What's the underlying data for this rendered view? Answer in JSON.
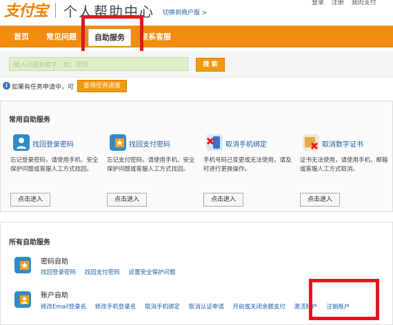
{
  "header": {
    "logo": "支付宝",
    "title": "个人帮助中心",
    "switch_link": "切换到商户版 >",
    "top_links": [
      "登录",
      "注册",
      "我的支付"
    ]
  },
  "nav": {
    "items": [
      {
        "label": "首页"
      },
      {
        "label": "常见问题"
      },
      {
        "label": "自助服务"
      },
      {
        "label": "联系客服"
      }
    ]
  },
  "search": {
    "placeholder": "输入问题关键字，如：提现",
    "button": "搜 索"
  },
  "info": {
    "text": "如果有任务申请中，可",
    "button": "查询任务进度"
  },
  "common": {
    "title": "常用自助服务",
    "services": [
      {
        "title": "找回登录密码",
        "desc": "忘记登录密码，请使用手机、安全保护问题或客服人工方式找回。",
        "button": "点击进入"
      },
      {
        "title": "找回支付密码",
        "desc": "忘记支付密码，请使用手机、安全保护问题或客服人工方式找回。",
        "button": "点击进入"
      },
      {
        "title": "取消手机绑定",
        "desc": "手机号码已变更或无法使用，请及时进行更换操作。",
        "button": "点击进入"
      },
      {
        "title": "取消数字证书",
        "desc": "证书无法使用，请使用手机、邮箱或客服人工方式取消。",
        "button": "点击进入"
      }
    ]
  },
  "all": {
    "title": "所有自助服务",
    "groups": [
      {
        "title": "密码自助",
        "links": [
          "找回登录密码",
          "找回支付密码",
          "设置安全保护问题"
        ]
      },
      {
        "title": "账户自助",
        "links": [
          "修改Email登录名",
          "修改手机登录名",
          "取消手机绑定",
          "取消认证申请",
          "开启或关闭余额支付",
          "激活账户",
          "注销账户"
        ]
      }
    ]
  },
  "colors": {
    "brand_orange": "#f08c10",
    "link_blue": "#1e5eab",
    "highlight_red": "#e1171e"
  }
}
